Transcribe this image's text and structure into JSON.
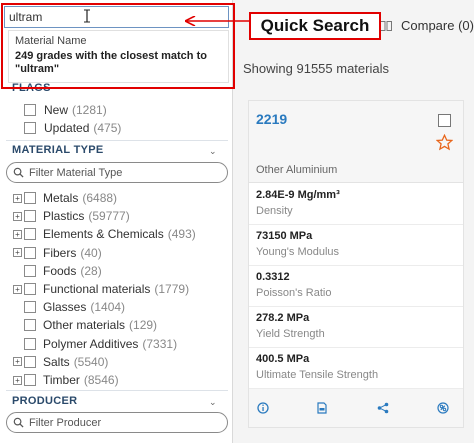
{
  "search": {
    "value": "ultram",
    "suggestion_title": "Material Name",
    "suggestion_text": "249 grades with the closest match to \"ultram\""
  },
  "callout": {
    "label": "Quick Search"
  },
  "flags": {
    "header_partial": "FLAGS",
    "items": [
      {
        "label": "New",
        "count": "(1281)"
      },
      {
        "label": "Updated",
        "count": "(475)"
      }
    ]
  },
  "material_type": {
    "header": "MATERIAL TYPE",
    "filter_placeholder": "Filter Material Type",
    "items": [
      {
        "label": "Metals",
        "count": "(6488)",
        "expandable": true
      },
      {
        "label": "Plastics",
        "count": "(59777)",
        "expandable": true
      },
      {
        "label": "Elements & Chemicals",
        "count": "(493)",
        "expandable": true
      },
      {
        "label": "Fibers",
        "count": "(40)",
        "expandable": true
      },
      {
        "label": "Foods",
        "count": "(28)",
        "expandable": false
      },
      {
        "label": "Functional materials",
        "count": "(1779)",
        "expandable": true
      },
      {
        "label": "Glasses",
        "count": "(1404)",
        "expandable": false
      },
      {
        "label": "Other materials",
        "count": "(129)",
        "expandable": false
      },
      {
        "label": "Polymer Additives",
        "count": "(7331)",
        "expandable": false
      },
      {
        "label": "Salts",
        "count": "(5540)",
        "expandable": true
      },
      {
        "label": "Timber",
        "count": "(8546)",
        "expandable": true
      }
    ]
  },
  "producer": {
    "header": "PRODUCER",
    "filter_placeholder": "Filter Producer"
  },
  "header": {
    "compare_label": "Compare (0)",
    "showing": "Showing 91555 materials"
  },
  "card": {
    "name": "2219",
    "category": "Other Aluminium",
    "properties": [
      {
        "value": "2.84E-9 Mg/mm³",
        "label": "Density"
      },
      {
        "value": "73150 MPa",
        "label": "Young's Modulus"
      },
      {
        "value": "0.3312",
        "label": "Poisson's Ratio"
      },
      {
        "value": "278.2 MPa",
        "label": "Yield Strength"
      },
      {
        "value": "400.5 MPa",
        "label": "Ultimate Tensile Strength"
      }
    ],
    "actions": [
      "info-icon",
      "datasheet-icon",
      "share-icon",
      "link-icon"
    ]
  },
  "colors": {
    "accent": "#2a7abf",
    "callout": "#e10000",
    "star": "#e8651a"
  }
}
